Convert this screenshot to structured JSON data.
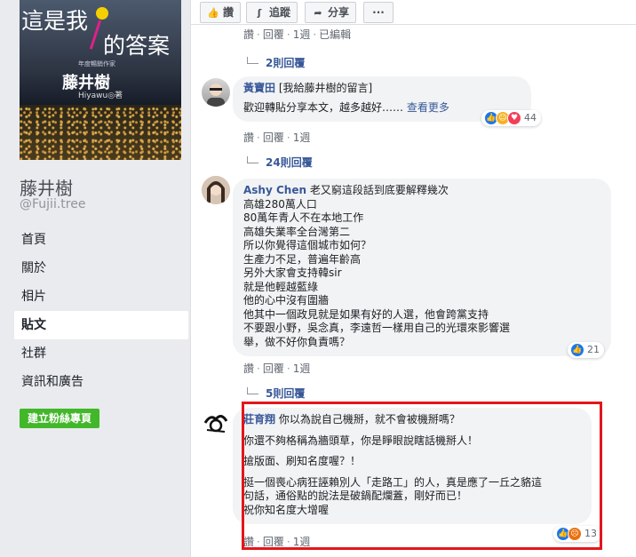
{
  "sidebar": {
    "cover": {
      "title_line1": "這是我",
      "title_line2": "的答案",
      "subtitle": "年度暢銷作家",
      "author": "藤井樹",
      "author_en": "Hiyawu",
      "author_suffix": "◎著"
    },
    "page_name": "藤井樹",
    "handle": "@Fujii.tree",
    "nav": [
      {
        "label": "首頁"
      },
      {
        "label": "關於"
      },
      {
        "label": "相片"
      },
      {
        "label": "貼文"
      },
      {
        "label": "社群"
      },
      {
        "label": "資訊和廣告"
      }
    ],
    "create_button": "建立粉絲專頁"
  },
  "action_bar": {
    "like": "讚",
    "follow": "追蹤",
    "share": "分享",
    "more": "···"
  },
  "comment_meta": {
    "like": "讚",
    "reply": "回覆",
    "sep": "·",
    "time": "1週",
    "edited": "已編輯"
  },
  "comments": [
    {
      "replies_label": "2則回覆"
    },
    {
      "author": "黃寶田",
      "text_lines": [
        "[我給藤井樹的留言]",
        "歡迎轉貼分享本文，越多越好……"
      ],
      "see_more": "查看更多",
      "reaction_count": "44",
      "replies_label": "24則回覆"
    },
    {
      "author": "Ashy Chen",
      "text_lines": [
        "老又窮這段話到底要解釋幾次",
        "高雄280萬人口",
        "80萬年青人不在本地工作",
        "高雄失業率全台灣第二",
        "所以你覺得這個城市如何？",
        "生產力不足，普遍年齡高",
        "另外大家會支持韓sir",
        "就是他輕越藍綠",
        "他的心中沒有圍牆",
        "他其中一個政見就是如果有好的人選，他會跨黨支持",
        "不要跟小野，吳念真，李遠哲一樣用自己的光環來影響選",
        "舉，做不好你負責嗎？"
      ],
      "reaction_count": "21",
      "replies_label": "5則回覆"
    },
    {
      "author": "莊育翔",
      "text_lines": [
        "你以為說自己機掰，就不會被機掰嗎？",
        "",
        "你還不夠格稱為牆頭草，你是睜眼說瞎話機掰人！",
        "",
        "搶版面、刷知名度喔？！",
        "",
        "挺一個喪心病狂誣賴別人「走路工」的人，真是應了一丘之貉這",
        "句話，通俗點的說法是破鍋配爛蓋，剛好而已！",
        "祝你知名度大增喔"
      ],
      "reaction_count": "13"
    }
  ],
  "colors": {
    "link_blue": "#385898",
    "highlight_red": "#e3161b",
    "button_green": "#42b72a",
    "bubble_gray": "#f2f3f5"
  }
}
